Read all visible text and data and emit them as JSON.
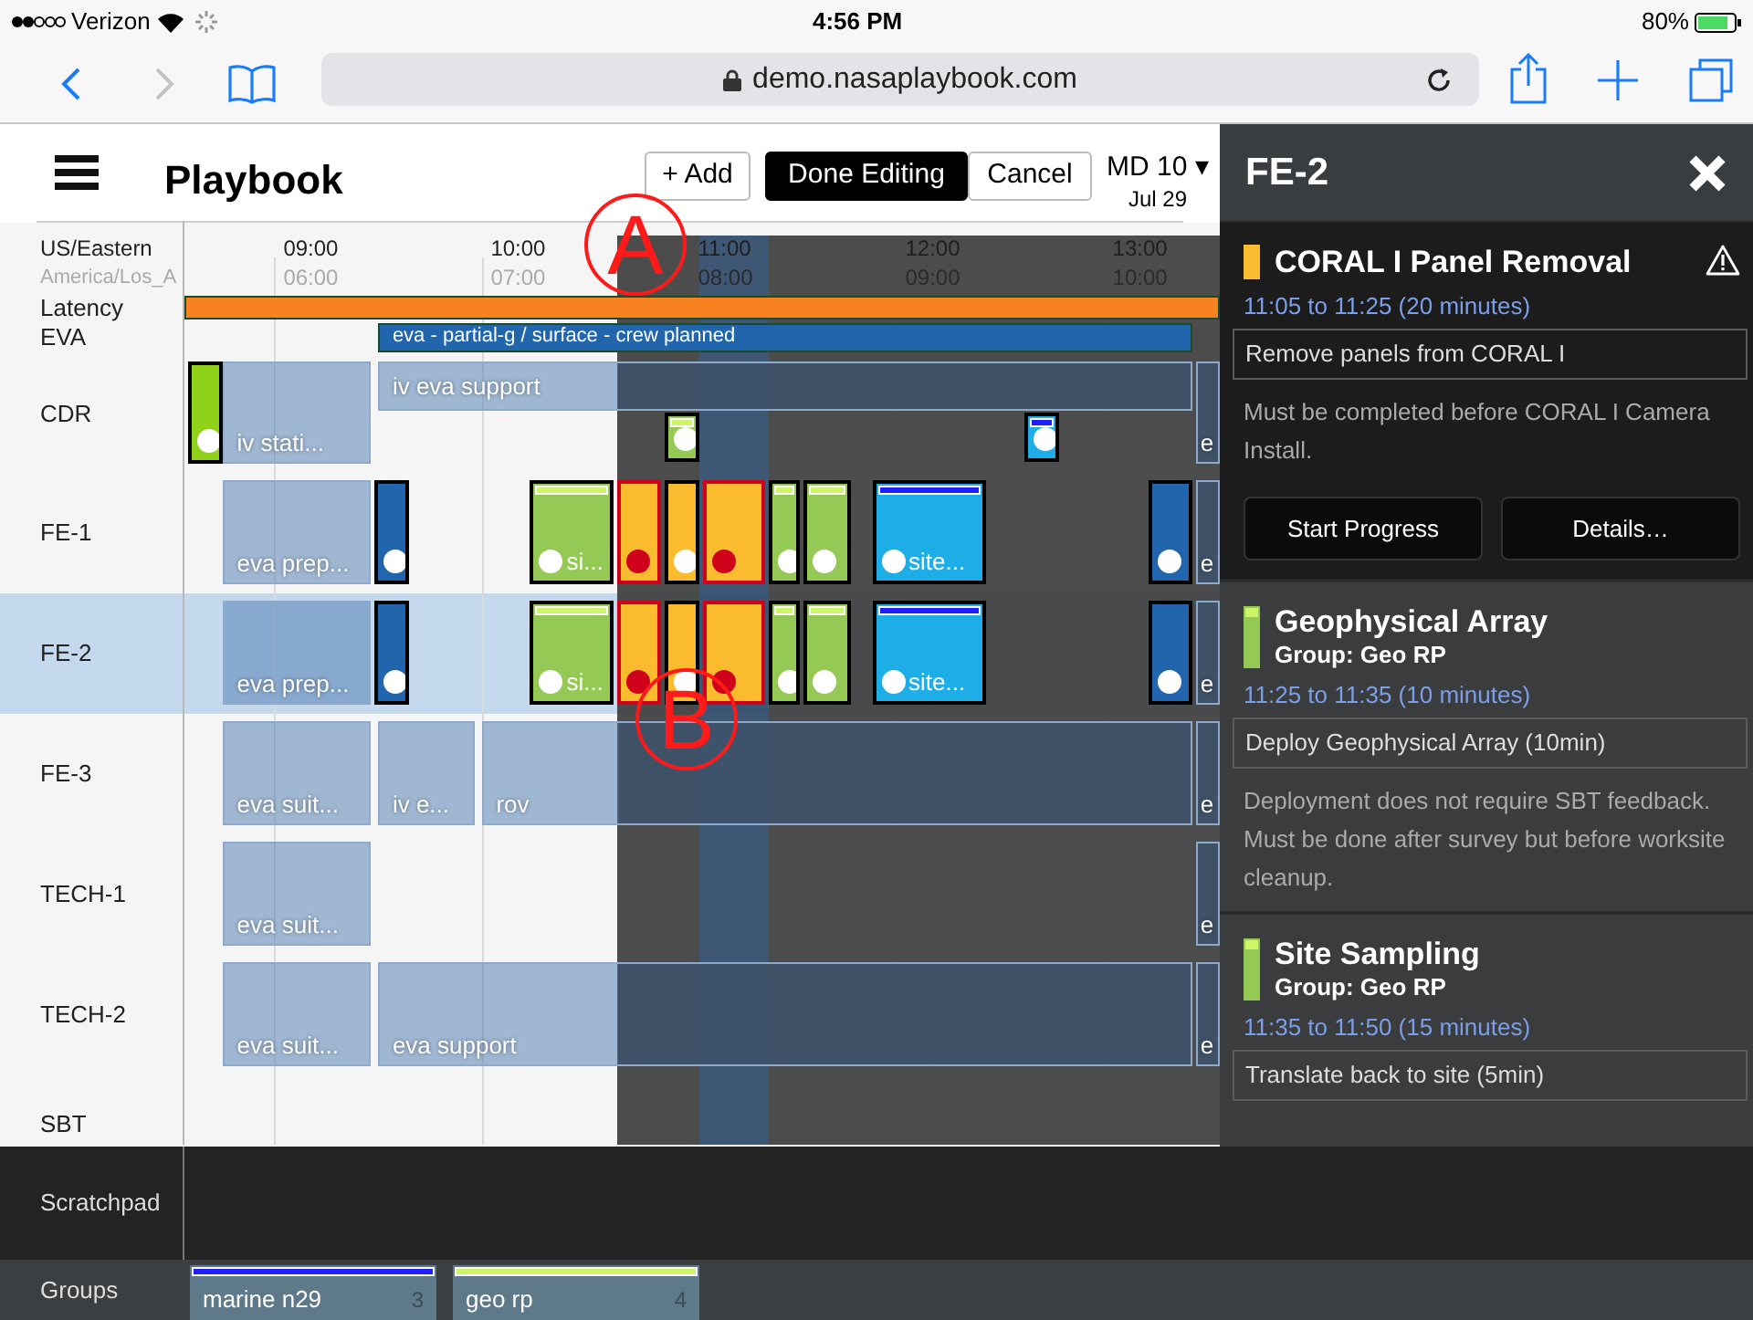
{
  "status_bar": {
    "carrier": "Verizon",
    "time": "4:56 PM",
    "battery": "80%"
  },
  "browser": {
    "url": "demo.nasaplaybook.com",
    "back_enabled": true,
    "forward_enabled": false
  },
  "app": {
    "title": "Playbook",
    "buttons": [
      {
        "label": "+ Add",
        "kind": "outline"
      },
      {
        "label": "Done Editing",
        "kind": "primary"
      },
      {
        "label": "Cancel",
        "kind": "outline"
      }
    ],
    "day": "MD 10 ▾",
    "date": "Jul 29"
  },
  "timeline": {
    "zones": [
      "US/Eastern",
      "America/Los_A"
    ],
    "hours": [
      {
        "primary": "09:00",
        "secondary": "06:00"
      },
      {
        "primary": "10:00",
        "secondary": "07:00"
      },
      {
        "primary": "11:00",
        "secondary": "08:00"
      },
      {
        "primary": "12:00",
        "secondary": "09:00"
      },
      {
        "primary": "13:00",
        "secondary": "10:00"
      }
    ],
    "rows": [
      {
        "label": "Latency",
        "kind": "bar",
        "bars": [
          {
            "color": "#f7821f"
          }
        ]
      },
      {
        "label": "EVA",
        "kind": "bar",
        "bars": [
          {
            "label": "eva - partial-g / surface - crew planned",
            "color": "#2166ad"
          }
        ]
      },
      {
        "label": "CDR",
        "kind": "crew",
        "selected": false,
        "blocks": [
          {
            "kind": "activity",
            "color": "#8fd018",
            "flagged": false
          },
          {
            "kind": "plan",
            "label": "iv stati..."
          },
          {
            "kind": "plan_strip",
            "label": "iv eva support"
          },
          {
            "kind": "mini_activity",
            "color": "#93c954",
            "stripe": {
              "color": "#ccf56a"
            },
            "flagged": false
          },
          {
            "kind": "mini_activity",
            "color": "#1daee8",
            "stripe": {
              "color": "#2020ff"
            },
            "flagged": false
          },
          {
            "kind": "plan",
            "label": "e"
          }
        ]
      },
      {
        "label": "FE-1",
        "kind": "crew",
        "selected": false,
        "blocks": [
          {
            "kind": "plan",
            "label": "eva prep..."
          },
          {
            "kind": "activity",
            "color": "#2166ad",
            "flagged": false
          },
          {
            "kind": "activity",
            "label": "si...",
            "color": "#93c954",
            "stripe": {
              "color": "#ccf56a"
            },
            "flagged": false
          },
          {
            "kind": "activity",
            "color": "#fbbb2e",
            "flagged": true
          },
          {
            "kind": "activity",
            "color": "#fbbb2e",
            "flagged": false
          },
          {
            "kind": "activity",
            "color": "#fbbb2e",
            "flagged": true
          },
          {
            "kind": "activity",
            "color": "#93c954",
            "stripe": {
              "color": "#ccf56a"
            },
            "flagged": false
          },
          {
            "kind": "activity",
            "color": "#93c954",
            "stripe": {
              "color": "#ccf56a"
            },
            "flagged": false
          },
          {
            "kind": "activity",
            "label": "site...",
            "color": "#1daee8",
            "stripe": {
              "color": "#2020ff"
            },
            "flagged": false
          },
          {
            "kind": "activity",
            "color": "#2166ad",
            "flagged": false
          },
          {
            "kind": "plan",
            "label": "e"
          }
        ]
      },
      {
        "label": "FE-2",
        "kind": "crew",
        "selected": true,
        "blocks": [
          {
            "kind": "plan",
            "label": "eva prep..."
          },
          {
            "kind": "activity",
            "color": "#2166ad",
            "flagged": false
          },
          {
            "kind": "activity",
            "label": "si...",
            "color": "#93c954",
            "stripe": {
              "color": "#ccf56a"
            },
            "flagged": false
          },
          {
            "kind": "activity",
            "color": "#fbbb2e",
            "flagged": true
          },
          {
            "kind": "activity",
            "color": "#fbbb2e",
            "flagged": false
          },
          {
            "kind": "activity",
            "color": "#fbbb2e",
            "flagged": true
          },
          {
            "kind": "activity",
            "color": "#93c954",
            "stripe": {
              "color": "#ccf56a"
            },
            "flagged": false
          },
          {
            "kind": "activity",
            "color": "#93c954",
            "stripe": {
              "color": "#ccf56a"
            },
            "flagged": false
          },
          {
            "kind": "activity",
            "label": "site...",
            "color": "#1daee8",
            "stripe": {
              "color": "#2020ff"
            },
            "flagged": false
          },
          {
            "kind": "activity",
            "color": "#2166ad",
            "flagged": false
          },
          {
            "kind": "plan",
            "label": "e"
          }
        ]
      },
      {
        "label": "FE-3",
        "kind": "crew",
        "selected": false,
        "blocks": [
          {
            "kind": "plan",
            "label": "eva suit..."
          },
          {
            "kind": "plan",
            "label": "iv e..."
          },
          {
            "kind": "plan",
            "label": "rov"
          },
          {
            "kind": "plan",
            "label": "e"
          }
        ]
      },
      {
        "label": "TECH-1",
        "kind": "crew",
        "selected": false,
        "blocks": [
          {
            "kind": "plan",
            "label": "eva suit..."
          },
          {
            "kind": "plan",
            "label": "e"
          }
        ]
      },
      {
        "label": "TECH-2",
        "kind": "crew",
        "selected": false,
        "blocks": [
          {
            "kind": "plan",
            "label": "eva suit..."
          },
          {
            "kind": "plan",
            "label": "eva support"
          },
          {
            "kind": "plan",
            "label": "e"
          }
        ]
      },
      {
        "label": "SBT",
        "kind": "short",
        "selected": false
      }
    ],
    "annotations": [
      {
        "label": "A"
      },
      {
        "label": "B"
      }
    ]
  },
  "scratchpad": {
    "label": "Scratchpad"
  },
  "groups": {
    "label": "Groups",
    "items": [
      {
        "name": "marine n29",
        "count": "3",
        "color": "#2020ff"
      },
      {
        "name": "geo rp",
        "count": "4",
        "color": "#ccf56a"
      }
    ]
  },
  "panel": {
    "title": "FE-2",
    "cards": [
      {
        "title": "CORAL I Panel Removal",
        "color": "#fbbb2e",
        "warning": true,
        "selected": true,
        "time": "11:05 to 11:25 (20 minutes)",
        "task": "Remove panels from CORAL I",
        "note": "Must be completed before CORAL I Camera Install.",
        "buttons": [
          "Start Progress",
          "Details…"
        ]
      },
      {
        "title": "Geophysical Array",
        "group": "Group: Geo RP",
        "color": "#93c954",
        "stripe": {
          "color": "#ccf56a"
        },
        "warning": false,
        "selected": false,
        "time": "11:25 to 11:35 (10 minutes)",
        "task": "Deploy Geophysical Array (10min)",
        "note": "Deployment does not require SBT feedback. Must be done after survey but before worksite cleanup."
      },
      {
        "title": "Site Sampling",
        "group": "Group: Geo RP",
        "color": "#93c954",
        "stripe": {
          "color": "#ccf56a"
        },
        "warning": false,
        "selected": false,
        "time": "11:35 to 11:50 (15 minutes)",
        "task": "Translate back to site (5min)"
      }
    ]
  }
}
